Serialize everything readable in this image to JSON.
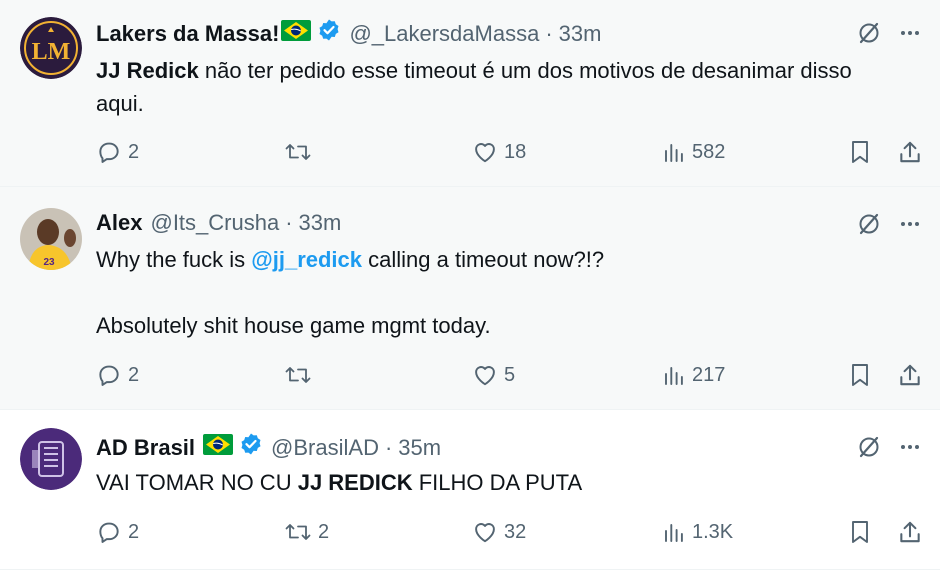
{
  "tweets": [
    {
      "name": "Lakers da Massa!",
      "verified": true,
      "flag": "brazil-flag",
      "handle": "@_LakersdaMassa",
      "dot": "·",
      "time": "33m",
      "text": {
        "part1_bold": "JJ Redick",
        "part2": " não ter pedido esse timeout é um dos motivos de desanimar disso aqui."
      },
      "avatar_text": "LM",
      "replies": "2",
      "retweets": "",
      "likes": "18",
      "views": "582"
    },
    {
      "name": "Alex",
      "verified": false,
      "handle": "@Its_Crusha",
      "dot": "·",
      "time": "33m",
      "text": {
        "line1_pre": "Why the fuck is ",
        "line1_mention": "@jj_redick",
        "line1_post": " calling a timeout now?!?",
        "line2": "Absolutely shit house game mgmt today."
      },
      "replies": "2",
      "retweets": "",
      "likes": "5",
      "views": "217"
    },
    {
      "name": "AD Brasil",
      "verified": true,
      "flag": "brazil-flag",
      "handle": "@BrasilAD",
      "dot": "·",
      "time": "35m",
      "text": {
        "part1": "VAI TOMAR NO CU ",
        "part2_bold": "JJ REDICK",
        "part3": " FILHO DA PUTA"
      },
      "replies": "2",
      "retweets": "2",
      "likes": "32",
      "views": "1.3K"
    }
  ],
  "colors": {
    "text": "#0f1419",
    "muted": "#536471",
    "accent": "#1d9bf0",
    "verified": "#1d9bf0"
  }
}
